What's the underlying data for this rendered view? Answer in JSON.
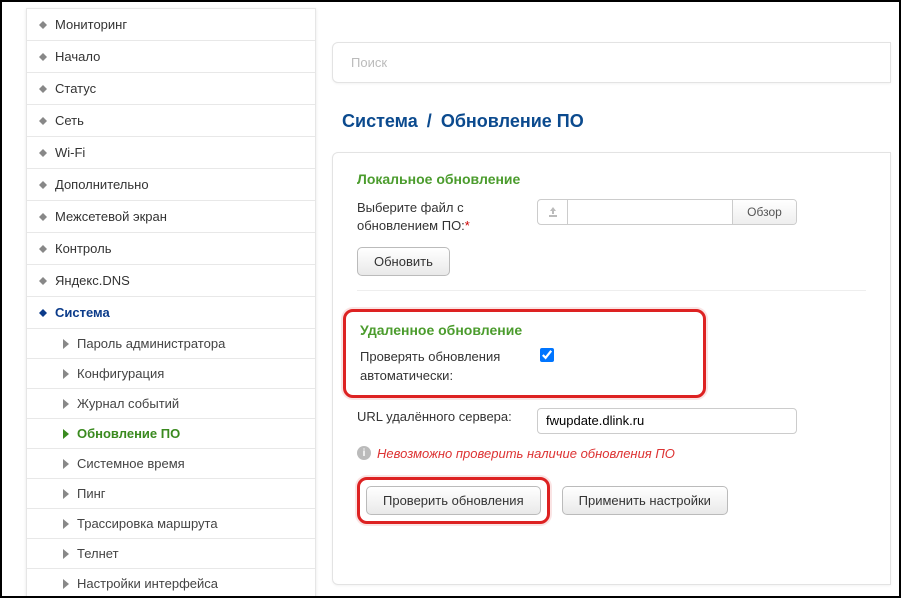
{
  "sidebar": {
    "items": [
      {
        "label": "Мониторинг"
      },
      {
        "label": "Начало"
      },
      {
        "label": "Статус"
      },
      {
        "label": "Сеть"
      },
      {
        "label": "Wi-Fi"
      },
      {
        "label": "Дополнительно"
      },
      {
        "label": "Межсетевой экран"
      },
      {
        "label": "Контроль"
      },
      {
        "label": "Яндекс.DNS"
      },
      {
        "label": "Система"
      }
    ],
    "sub_items": [
      {
        "label": "Пароль администратора"
      },
      {
        "label": "Конфигурация"
      },
      {
        "label": "Журнал событий"
      },
      {
        "label": "Обновление ПО"
      },
      {
        "label": "Системное время"
      },
      {
        "label": "Пинг"
      },
      {
        "label": "Трассировка маршрута"
      },
      {
        "label": "Телнет"
      },
      {
        "label": "Настройки интерфейса"
      }
    ]
  },
  "search": {
    "placeholder": "Поиск"
  },
  "breadcrumb": {
    "parent": "Система",
    "current": "Обновление ПО"
  },
  "local_update": {
    "title": "Локальное обновление",
    "file_label": "Выберите файл с обновлением ПО:",
    "browse": "Обзор",
    "update_btn": "Обновить"
  },
  "remote_update": {
    "title": "Удаленное обновление",
    "auto_check_label": "Проверять обновления автоматически:",
    "auto_check_value": true,
    "url_label": "URL удалённого сервера:",
    "url_value": "fwupdate.dlink.ru",
    "error_text": "Невозможно проверить наличие обновления ПО",
    "check_btn": "Проверить обновления",
    "apply_btn": "Применить настройки"
  }
}
